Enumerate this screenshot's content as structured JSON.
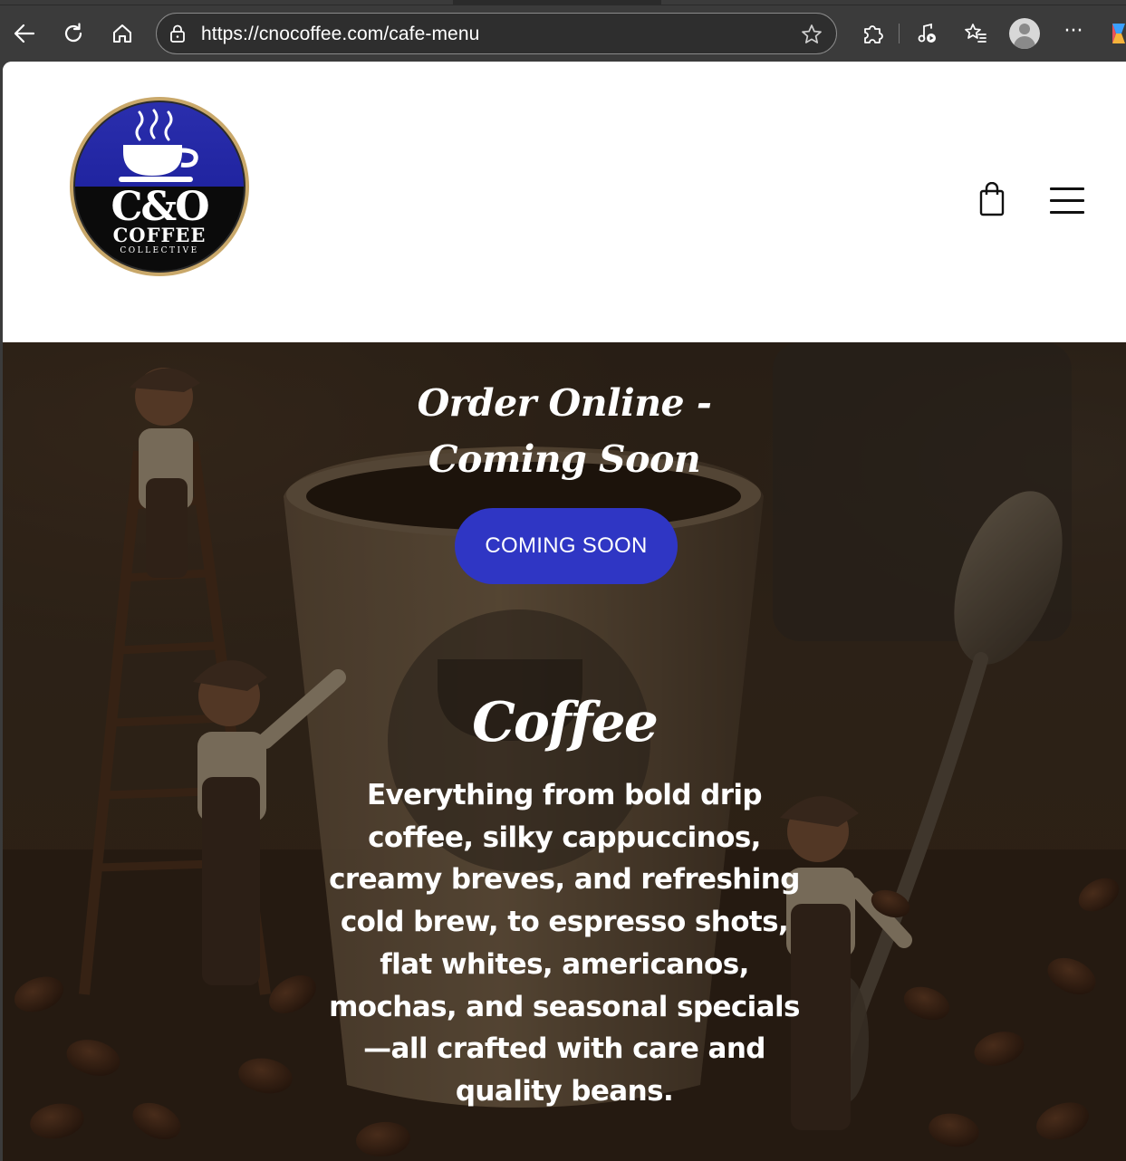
{
  "browser": {
    "url": "https://cnocoffee.com/cafe-menu",
    "icons": {
      "back": "arrow-left-icon",
      "refresh": "refresh-icon",
      "home": "home-icon",
      "lock": "lock-icon",
      "favorite": "star-icon",
      "extensions": "puzzle-icon",
      "media": "music-icon",
      "favorites": "favorites-list-icon",
      "profile": "profile-icon",
      "more": "ellipsis-icon",
      "copilot": "copilot-icon"
    },
    "more_label": "···"
  },
  "header": {
    "logo": {
      "wordmark": "C&O",
      "line2": "COFFEE",
      "line3": "COLLECTIVE"
    },
    "icons": {
      "cart": "shopping-bag-icon",
      "menu": "hamburger-menu-icon"
    }
  },
  "hero": {
    "title": "Order Online - Coming Soon",
    "cta_label": "COMING SOON",
    "section_title": "Coffee",
    "section_description": "Everything from bold drip coffee, silky cappuccinos, creamy breves, and refreshing cold brew, to espresso shots, flat whites, americanos, mochas, and seasonal specials—all crafted with care and quality beans."
  },
  "colors": {
    "browser_chrome": "#3b3b3b",
    "cta_background": "#2f36c4",
    "logo_blue": "#2a2fa8",
    "logo_gold": "#c9a86a",
    "hero_text": "#ffffff"
  }
}
